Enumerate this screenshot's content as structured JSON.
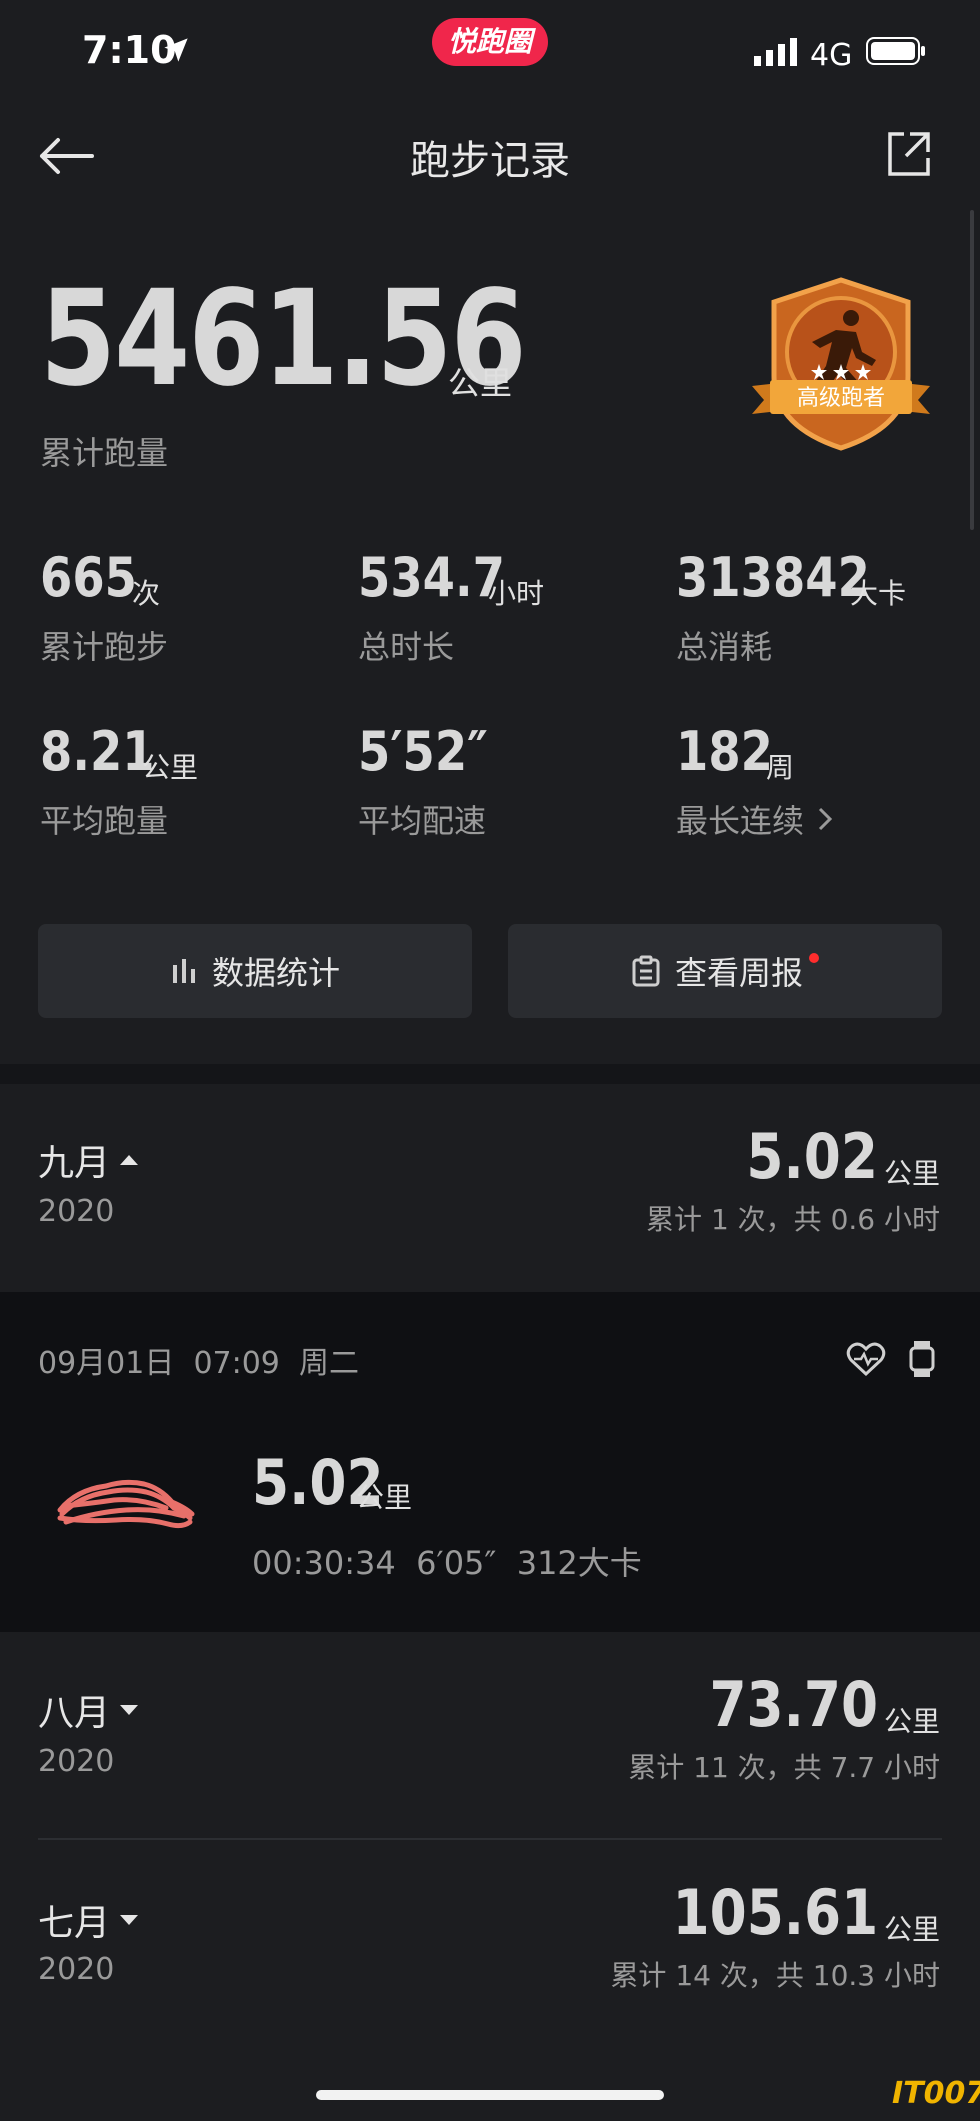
{
  "status": {
    "time": "7:10",
    "network": "4G",
    "brand_pill": "悦跑圈"
  },
  "header": {
    "title": "跑步记录"
  },
  "total": {
    "distance": "5461.56",
    "unit": "公里",
    "label": "累计跑量"
  },
  "badge": {
    "text": "高级跑者",
    "stars": 3
  },
  "stats": [
    {
      "value": "665",
      "unit": "次",
      "label": "累计跑步"
    },
    {
      "value": "534.7",
      "unit": "小时",
      "label": "总时长"
    },
    {
      "value": "313842",
      "unit": "大卡",
      "label": "总消耗"
    },
    {
      "value": "8.21",
      "unit": "公里",
      "label": "平均跑量"
    },
    {
      "value": "5′52″",
      "unit": "",
      "label": "平均配速"
    },
    {
      "value": "182",
      "unit": "周",
      "label": "最长连续"
    }
  ],
  "buttons": {
    "stats_label": "数据统计",
    "weekly_label": "查看周报"
  },
  "months": [
    {
      "name": "九月",
      "year": "2020",
      "distance": "5.02",
      "unit": "公里",
      "summary": "累计 1 次，共 0.6 小时",
      "expanded": true
    },
    {
      "name": "八月",
      "year": "2020",
      "distance": "73.70",
      "unit": "公里",
      "summary": "累计 11 次，共 7.7 小时",
      "expanded": false
    },
    {
      "name": "七月",
      "year": "2020",
      "distance": "105.61",
      "unit": "公里",
      "summary": "累计 14 次，共 10.3 小时",
      "expanded": false
    }
  ],
  "record": {
    "date": "09月01日",
    "time": "07:09",
    "weekday": "周二",
    "distance": "5.02",
    "unit": "公里",
    "duration": "00:30:34",
    "pace": "6′05″",
    "calories": "312大卡"
  },
  "watermark": "IT007",
  "colors": {
    "accent_red": "#f0264b",
    "badge_orange": "#e0782a",
    "background": "#1c1d20"
  }
}
